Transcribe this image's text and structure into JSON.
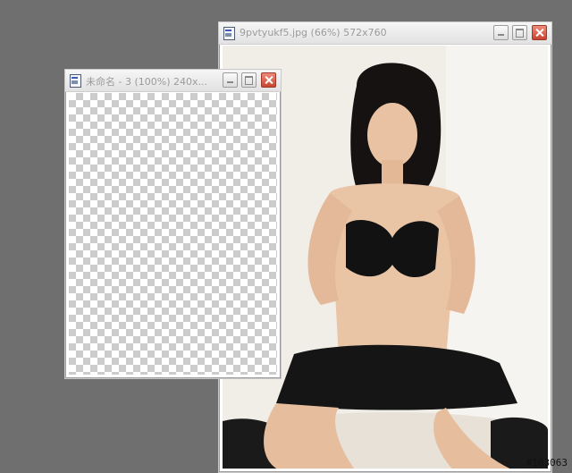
{
  "windows": {
    "photo": {
      "title": "9pvtyukf5.jpg (66%) 572x760"
    },
    "blank": {
      "title": "未命名 - 3 (100%) 240x..."
    }
  },
  "watermark": "#103063",
  "colors": {
    "desktop": "#6f6f6f",
    "close_button": "#c9442f"
  },
  "icons": {
    "doc": "document-icon",
    "minimize": "minimize-icon",
    "maximize": "maximize-icon",
    "close": "close-icon"
  }
}
